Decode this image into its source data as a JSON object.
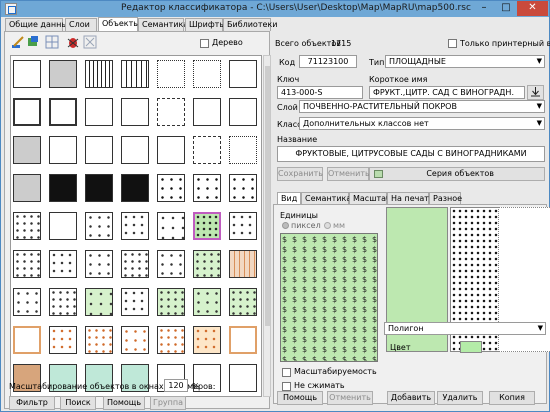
{
  "window": {
    "title": "Редактор классификатора - C:\\Users\\User\\Desktop\\Map\\MapRU\\map500.rsc",
    "icon": "map-app-icon",
    "minimize": "–",
    "maximize": "□",
    "close": "✕"
  },
  "tabs": [
    "Общие данные",
    "Слои",
    "Объекты",
    "Семантика",
    "Шрифты",
    "Библиотеки"
  ],
  "left": {
    "tree_checkbox_label": "Дерево",
    "scale_label": "Масштабирование объектов в окнах - примеров:",
    "scale_value": "120",
    "scale_unit": "%",
    "buttons": [
      "Фильтр",
      "Поиск",
      "Помощь",
      "Группа"
    ]
  },
  "right": {
    "total_label": "Всего объектов",
    "total_value": "1715",
    "printer_checkbox_label": "Только принтерный вид",
    "code_label": "Код",
    "code_value": "71123100",
    "type_label": "Тип",
    "type_value": "ПЛОЩАДНЫЕ",
    "key_label": "Ключ",
    "key_value": "413-000-S",
    "short_name_label": "Короткое имя",
    "short_name_value": "ФРУКТ.,ЦИТР. САД С  ВИНОГРАДН.",
    "layer_label": "Слой",
    "layer_value": "ПОЧВЕННО-РАСТИТЕЛЬНЫЙ ПОКРОВ",
    "class_label": "Класс",
    "class_value": "Дополнительных классов нет",
    "name_label": "Название",
    "name_value": "ФРУКТОВЫЕ, ЦИТРУСОВЫЕ САДЫ С  ВИНОГРАДНИКАМИ",
    "save_button": "Сохранить",
    "cancel_button": "Отменить",
    "series_button": "Серия объектов",
    "view_tabs": [
      "Вид",
      "Семантика",
      "Масштаб",
      "На печать",
      "Разное"
    ],
    "units_label": "Единицы",
    "units_pixels": "пиксел",
    "units_mm": "мм",
    "scalable_label": "Масштабируемость",
    "no_compress_label": "Не сжимать",
    "polygon_value": "Полигон",
    "color_label": "Цвет",
    "color_value": "#b4eca8",
    "bottom_buttons": [
      "Помощь",
      "Отменить",
      "Добавить",
      "Удалить",
      "Копия"
    ]
  },
  "colors": {
    "accent": "#6fa8d6",
    "close": "#c94a3c",
    "selection": "#c05cc0",
    "preview_fill": "#bde8b0"
  }
}
